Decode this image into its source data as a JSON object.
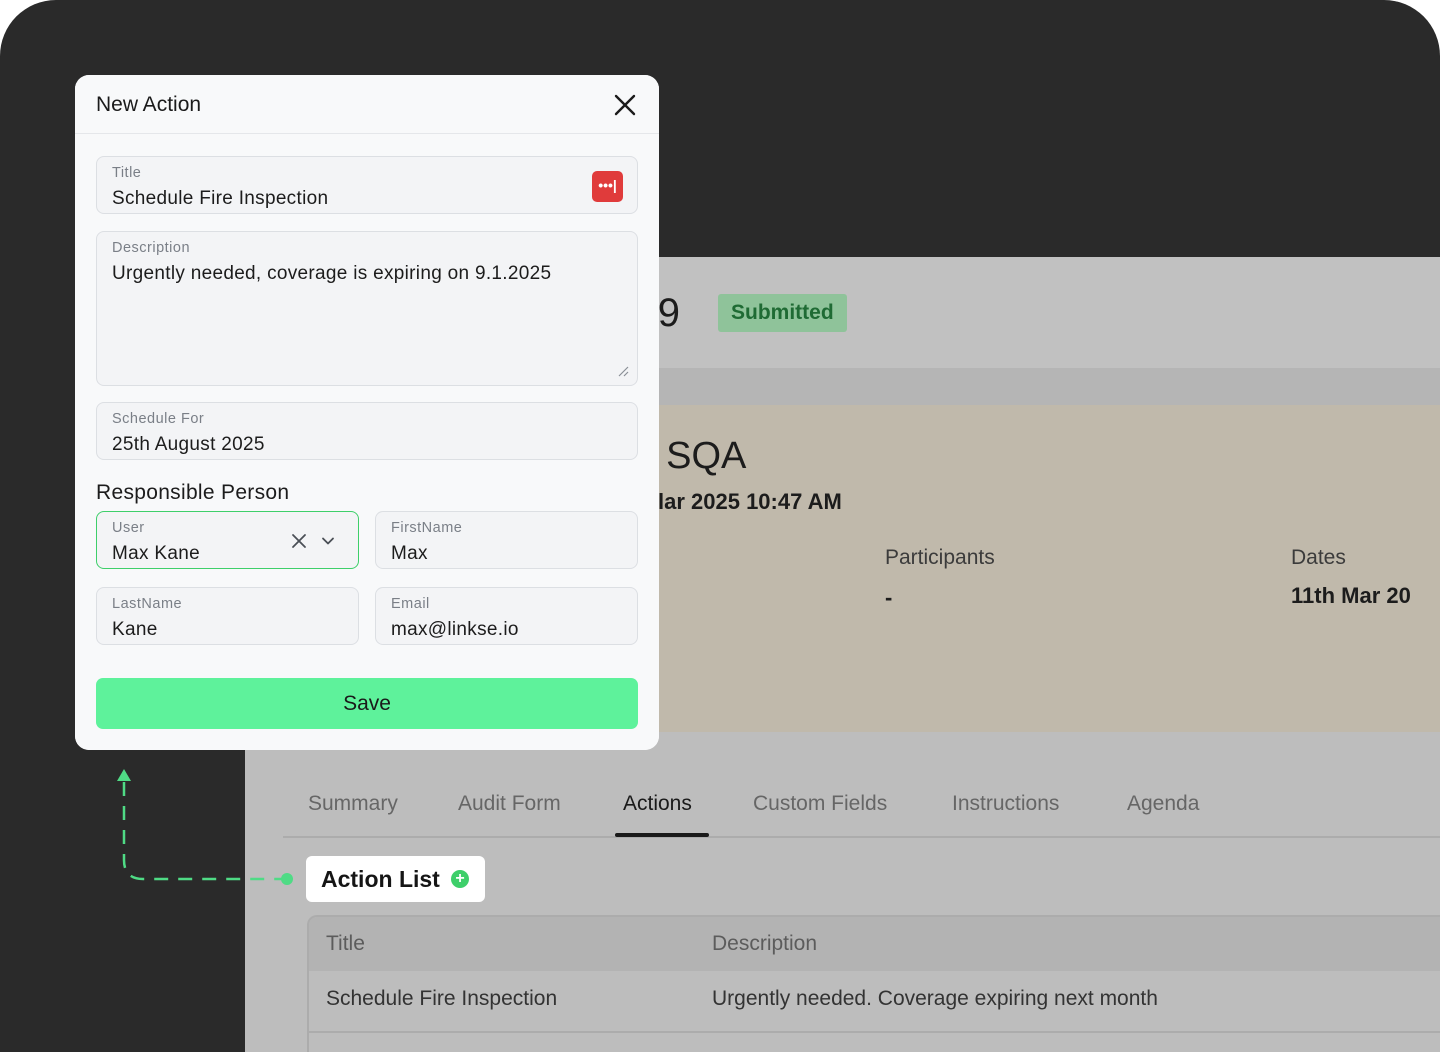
{
  "background": {
    "page_heading": "09",
    "status_badge": "Submitted",
    "info": {
      "title": ": SQA",
      "datetime": "lar 2025 10:47 AM",
      "participants_label": "Participants",
      "participants_value": "-",
      "dates_label": "Dates",
      "dates_value": "11th Mar 20"
    },
    "tabs": [
      "Summary",
      "Audit Form",
      "Actions",
      "Custom Fields",
      "Instructions",
      "Agenda"
    ],
    "active_tab": "Actions",
    "table": {
      "headers": [
        "Title",
        "Description"
      ],
      "rows": [
        [
          "Schedule Fire Inspection",
          "Urgently needed. Coverage expiring next month"
        ]
      ]
    }
  },
  "action_list": {
    "label": "Action List",
    "add_icon": "plus-circle-icon",
    "accent_color": "#3ecf6a"
  },
  "modal": {
    "title": "New Action",
    "close_icon": "close-icon",
    "fields": {
      "title": {
        "label": "Title",
        "value": "Schedule Fire Inspection"
      },
      "description": {
        "label": "Description",
        "value": "Urgently needed, coverage is expiring on 9.1.2025"
      },
      "schedule_for": {
        "label": "Schedule For",
        "value": "25th August 2025"
      },
      "user": {
        "label": "User",
        "value": "Max Kane"
      },
      "first_name": {
        "label": "FirstName",
        "value": "Max"
      },
      "last_name": {
        "label": "LastName",
        "value": "Kane"
      },
      "email": {
        "label": "Email",
        "value": "max@linkse.io"
      }
    },
    "section_title": "Responsible Person",
    "save_label": "Save",
    "save_color": "#5ef29b",
    "password_icon_glyph": "•••|"
  }
}
